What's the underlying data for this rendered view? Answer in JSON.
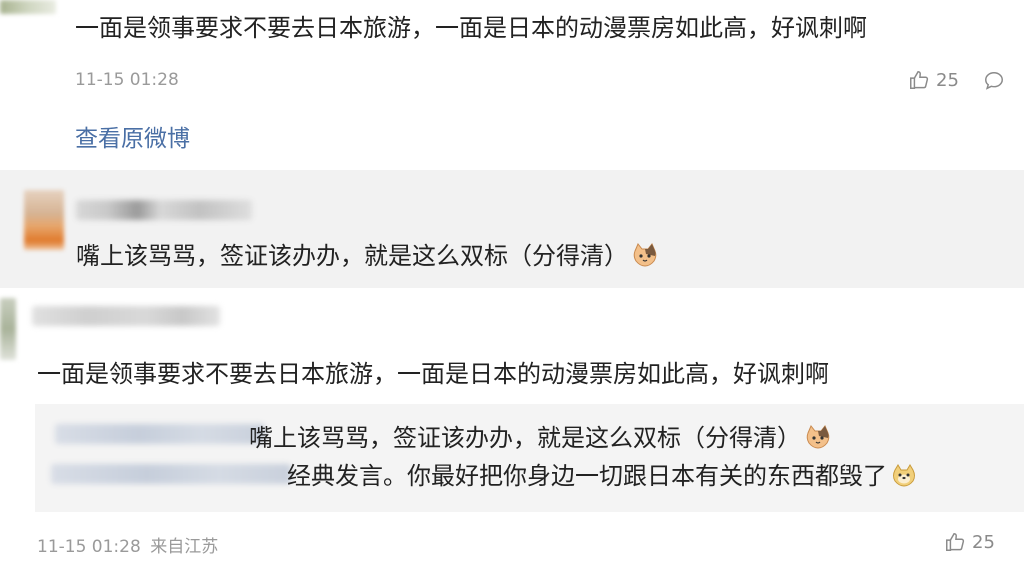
{
  "comment1": {
    "text": "一面是领事要求不要去日本旅游，一面是日本的动漫票房如此高，好讽刺啊",
    "time": "11-15 01:28",
    "likes": "25",
    "view_original": "查看原微博"
  },
  "reply1": {
    "text": "嘴上该骂骂，签证该办办，就是这么双标（分得清）"
  },
  "comment2": {
    "text": "一面是领事要求不要去日本旅游，一面是日本的动漫票房如此高，好讽刺啊",
    "quote_line1": "嘴上该骂骂，签证该办办，就是这么双标（分得清）",
    "quote_line2": "经典发言。你最好把你身边一切跟日本有关的东西都毁了",
    "time": "11-15 01:28",
    "location": "来自江苏",
    "likes": "25"
  },
  "colors": {
    "link": "#4a6fa5",
    "meta": "#9a9a9a",
    "panel": "#f2f2f2"
  },
  "icons": [
    "thumbs-up-icon",
    "comment-icon",
    "cat-emoji-icon",
    "doge-emoji-icon"
  ]
}
